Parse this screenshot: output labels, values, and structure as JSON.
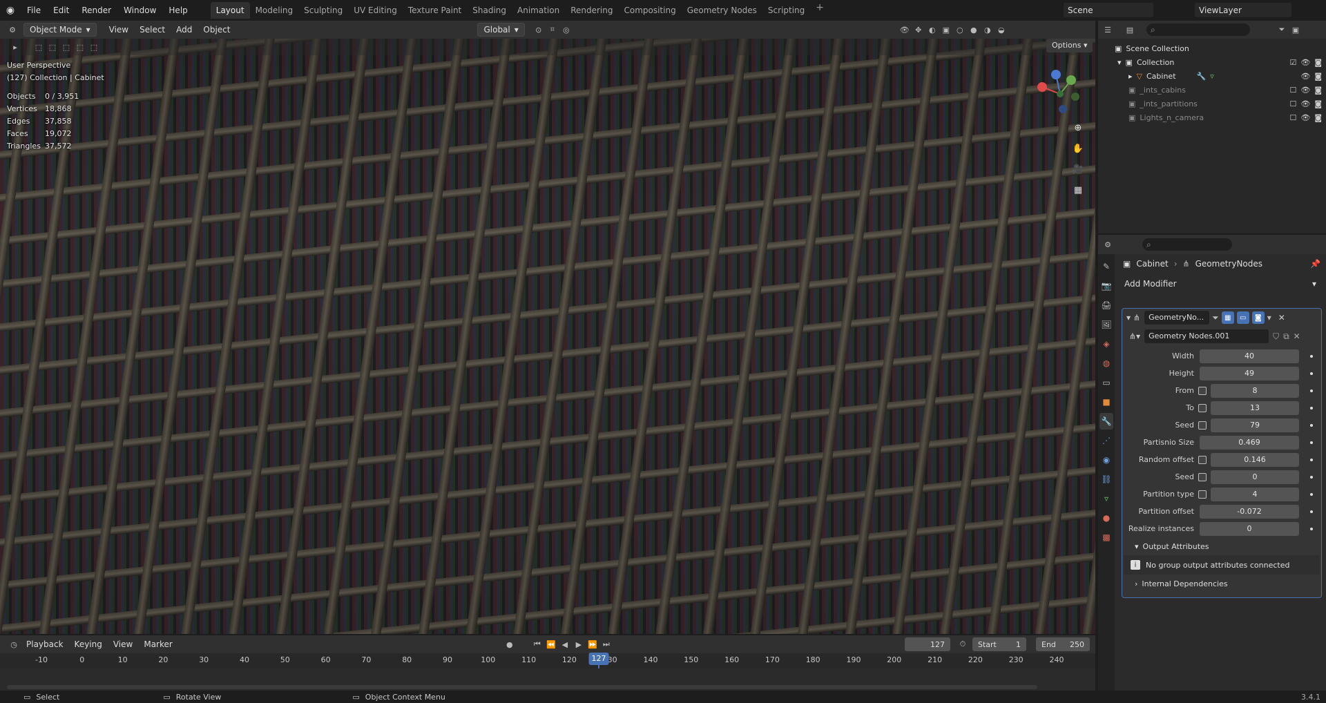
{
  "topbar": {
    "menus": [
      "File",
      "Edit",
      "Render",
      "Window",
      "Help"
    ],
    "workspaces": [
      "Layout",
      "Modeling",
      "Sculpting",
      "UV Editing",
      "Texture Paint",
      "Shading",
      "Animation",
      "Rendering",
      "Compositing",
      "Geometry Nodes",
      "Scripting"
    ],
    "active_workspace": "Layout",
    "scene": "Scene",
    "view_layer": "ViewLayer"
  },
  "viewport": {
    "mode": "Object Mode",
    "menus": [
      "View",
      "Select",
      "Add",
      "Object"
    ],
    "transform_orientation": "Global",
    "options_label": "Options",
    "perspective_label": "User Perspective",
    "collection_label": "(127) Collection | Cabinet",
    "stats": [
      {
        "key": "Objects",
        "value": "0 / 3,951"
      },
      {
        "key": "Vertices",
        "value": "18,868"
      },
      {
        "key": "Edges",
        "value": "37,858"
      },
      {
        "key": "Faces",
        "value": "19,072"
      },
      {
        "key": "Triangles",
        "value": "37,572"
      }
    ],
    "gizmo": {
      "x_color": "#e04a4a",
      "y_color": "#6aa84f",
      "z_color": "#4a7bd0"
    }
  },
  "timeline": {
    "menus": [
      "Playback",
      "Keying",
      "View",
      "Marker"
    ],
    "current_frame": "127",
    "start_label": "Start",
    "start": "1",
    "end_label": "End",
    "end": "250",
    "ticks": [
      "-10",
      "0",
      "10",
      "20",
      "30",
      "40",
      "50",
      "60",
      "70",
      "80",
      "90",
      "100",
      "110",
      "120",
      "130",
      "140",
      "150",
      "160",
      "170",
      "180",
      "190",
      "200",
      "210",
      "220",
      "230",
      "240"
    ]
  },
  "statusbar": {
    "select": "Select",
    "rotate": "Rotate View",
    "context": "Object Context Menu",
    "version": "3.4.1"
  },
  "outliner": {
    "rows": [
      {
        "label": "Scene Collection"
      },
      {
        "label": "Collection"
      },
      {
        "label": "Cabinet"
      },
      {
        "label": "_ints_cabins"
      },
      {
        "label": "_ints_partitions"
      },
      {
        "label": "Lights_n_camera"
      }
    ]
  },
  "properties": {
    "object": "Cabinet",
    "modifier_type": "GeometryNodes",
    "add_modifier": "Add Modifier",
    "modifier_name": "GeometryNo...",
    "node_group": "Geometry Nodes.001",
    "params": [
      {
        "label": "Width",
        "value": "40"
      },
      {
        "label": "Height",
        "value": "49"
      },
      {
        "label": "From",
        "value": "8"
      },
      {
        "label": "To",
        "value": "13"
      },
      {
        "label": "Seed",
        "value": "79"
      },
      {
        "label": "Partisnio Size",
        "value": "0.469"
      },
      {
        "label": "Random offset",
        "value": "0.146"
      },
      {
        "label": "Seed",
        "value": "0"
      },
      {
        "label": "Partition type",
        "value": "4"
      },
      {
        "label": "Partition offset",
        "value": "-0.072"
      },
      {
        "label": "Realize instances",
        "value": "0"
      }
    ],
    "output_attributes": "Output Attributes",
    "no_outputs": "No group output attributes connected",
    "internal_deps": "Internal Dependencies"
  }
}
